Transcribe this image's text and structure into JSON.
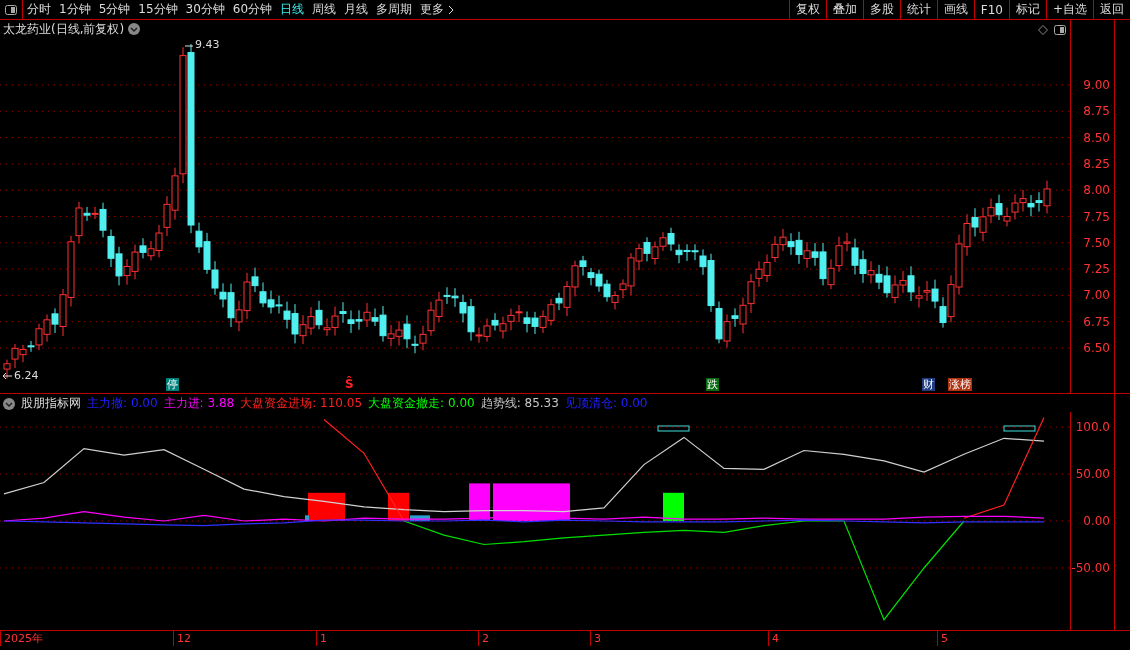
{
  "toolbar": {
    "periods": [
      {
        "label": "分时",
        "selected": false
      },
      {
        "label": "1分钟",
        "selected": false
      },
      {
        "label": "5分钟",
        "selected": false
      },
      {
        "label": "15分钟",
        "selected": false
      },
      {
        "label": "30分钟",
        "selected": false
      },
      {
        "label": "60分钟",
        "selected": false
      },
      {
        "label": "日线",
        "selected": true
      },
      {
        "label": "周线",
        "selected": false
      },
      {
        "label": "月线",
        "selected": false
      },
      {
        "label": "多周期",
        "selected": false
      }
    ],
    "more": "更多",
    "actions": [
      "复权",
      "叠加",
      "多股",
      "统计",
      "画线",
      "F10",
      "标记",
      "+自选",
      "返回"
    ]
  },
  "price_chart": {
    "title": "太龙药业(日线,前复权)",
    "high_label": "9.43",
    "low_label": "6.24",
    "markers": [
      {
        "text": "停",
        "kind": "tag",
        "color": "#00807a"
      },
      {
        "text": "Ŝ",
        "kind": "symbol",
        "color": "#ff2020"
      },
      {
        "text": "跌",
        "kind": "tag",
        "color": "#0a6a10"
      },
      {
        "text": "财",
        "kind": "tag",
        "color": "#203c80"
      },
      {
        "text": "涨榜",
        "kind": "tag",
        "color": "#b03010"
      }
    ],
    "axis_labels": [
      "9.00",
      "8.75",
      "8.50",
      "8.25",
      "8.00",
      "7.75",
      "7.50",
      "7.25",
      "7.00",
      "6.75",
      "6.50"
    ]
  },
  "indicator": {
    "name": "股朋指标网",
    "items": [
      {
        "label": "主力撤:",
        "value": "0.00",
        "color": "#2020ff"
      },
      {
        "label": "主力进:",
        "value": "3.88",
        "color": "#ff00ff"
      },
      {
        "label": "大盘资金进场:",
        "value": "110.05",
        "color": "#ff2020"
      },
      {
        "label": "大盘资金撤走:",
        "value": "0.00",
        "color": "#00ff00"
      },
      {
        "label": "趋势线:",
        "value": "85.33",
        "color": "#c8c8c8"
      },
      {
        "label": "见顶清仓:",
        "value": "0.00",
        "color": "#2020ff"
      }
    ],
    "chart_data": {
      "type": "line",
      "grid": true,
      "ylim": [
        -116,
        116
      ],
      "yticks": [
        {
          "value": 100,
          "label": "100.0"
        },
        {
          "value": 50,
          "label": "50.00"
        },
        {
          "value": 0,
          "label": "0.00"
        },
        {
          "value": -50,
          "label": "-50.00"
        }
      ],
      "series": [
        {
          "color": "#d0d0d0",
          "values": [
            29,
            41,
            77,
            70,
            76,
            55,
            34,
            26,
            21,
            15,
            12,
            10,
            11,
            11,
            10,
            14,
            60,
            89,
            56,
            55,
            75,
            71,
            64,
            52,
            71,
            88,
            85
          ]
        },
        {
          "color": "#ff2020",
          "values": [
            null,
            null,
            null,
            null,
            null,
            null,
            null,
            null,
            108,
            72,
            0,
            null,
            null,
            null,
            null,
            null,
            null,
            null,
            null,
            null,
            null,
            null,
            null,
            null,
            3,
            17,
            110
          ]
        },
        {
          "color": "#00e000",
          "values": [
            null,
            null,
            null,
            null,
            null,
            null,
            null,
            null,
            null,
            null,
            0,
            -15,
            -25,
            -22,
            -18,
            -15,
            -12,
            -10,
            -12,
            -5,
            0,
            0,
            -105,
            -50,
            0,
            null,
            null
          ]
        },
        {
          "color": "#ff00ff",
          "values": [
            0,
            3,
            10,
            4,
            0,
            6,
            0,
            2,
            0,
            3,
            2,
            2,
            3,
            5,
            3,
            2,
            4,
            2,
            2,
            3,
            2,
            2,
            2,
            4,
            5,
            5,
            3
          ]
        },
        {
          "color": "#3030ff",
          "values": [
            0,
            -1,
            -2,
            -3,
            -4,
            -5,
            -3,
            -2,
            1,
            1,
            0,
            0,
            1,
            -1,
            1,
            0,
            -1,
            -1,
            -1,
            0,
            1,
            0,
            -1,
            -2,
            -1,
            -1,
            -1
          ]
        }
      ]
    }
  },
  "date_axis": [
    "2025年",
    "12",
    "1",
    "2",
    "3",
    "4",
    "5"
  ]
}
